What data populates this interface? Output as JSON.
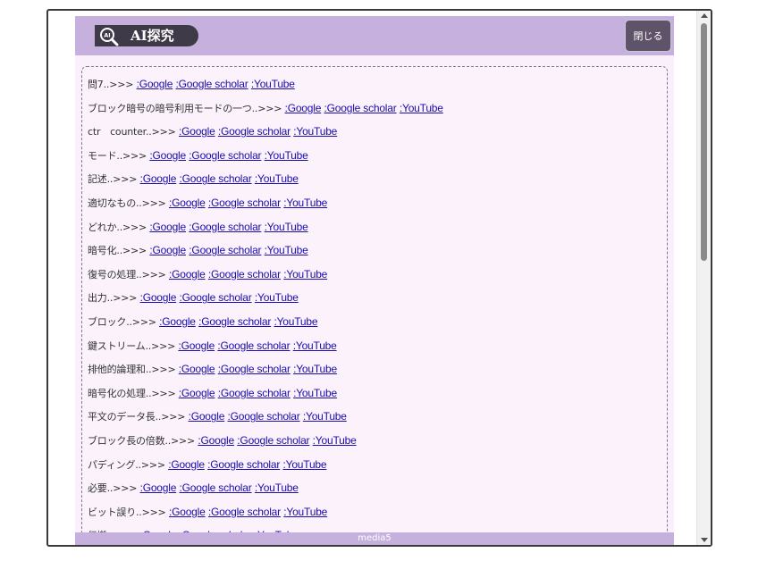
{
  "header": {
    "title": "AI探究",
    "close_label": "閉じる"
  },
  "footer": {
    "text": "media5"
  },
  "links": {
    "separator": "..>>>",
    "google": ":Google",
    "scholar": ":Google scholar",
    "youtube": ":YouTube"
  },
  "items": [
    "問7",
    "ブロック暗号の暗号利用モードの一つ",
    "ctr　counter",
    "モード",
    "記述",
    "適切なもの",
    "どれか",
    "暗号化",
    "復号の処理",
    "出力",
    "ブロック",
    "鍵ストリーム",
    "排他的論理和",
    "暗号化の処理",
    "平文のデータ長",
    "ブロック長の倍数",
    "パディング",
    "必要",
    "ビット誤り",
    "伝搬"
  ],
  "colors": {
    "header_bg": "#c6b0dd",
    "badge_bg": "#3f3a48",
    "link": "#1a0dab",
    "panel_bg": "#faf0fb"
  }
}
